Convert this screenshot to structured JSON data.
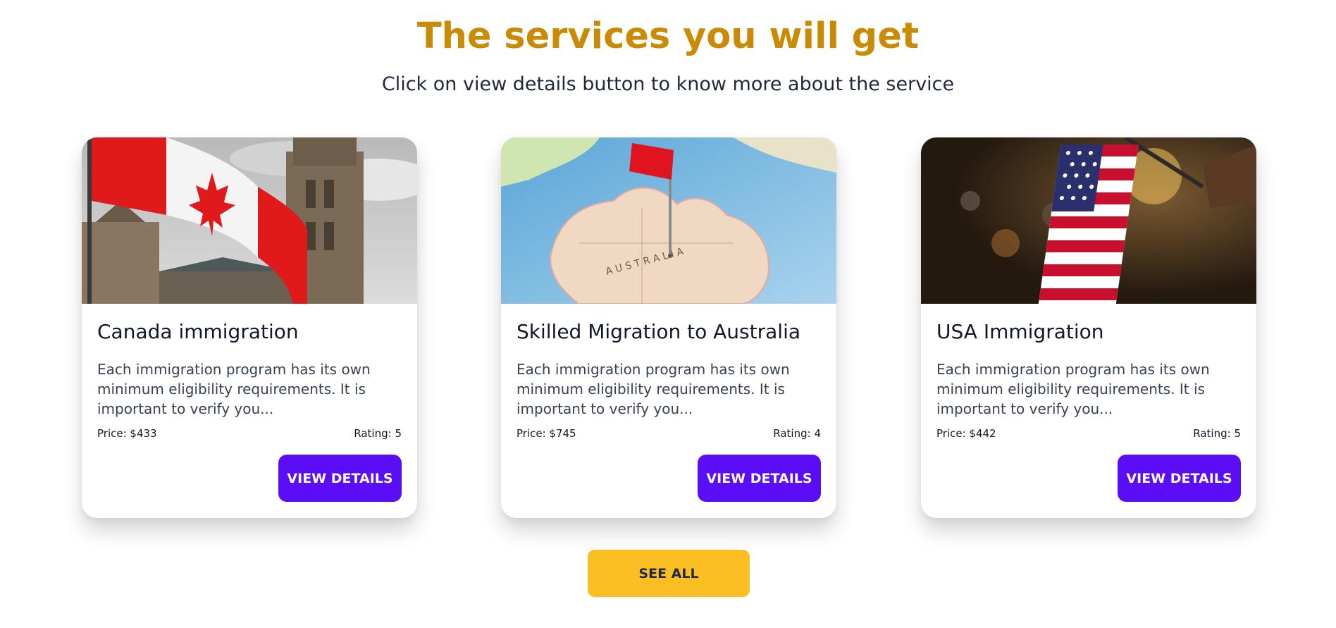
{
  "section": {
    "heading": "The services you will get",
    "subheading": "Click on view details button to know more about the service"
  },
  "colors": {
    "heading": "#ca8a04",
    "details_button": "#5b0ef5",
    "see_all_button": "#fbbf24"
  },
  "services": [
    {
      "image_icon": "canada-flag-parliament-image",
      "title": "Canada immigration",
      "description": "Each immigration program has its own minimum eligibility requirements. It is important to verify you...",
      "price": "Price: $433",
      "rating": "Rating: 5",
      "button_label": "VIEW DETAILS"
    },
    {
      "image_icon": "australia-map-pin-image",
      "title": "Skilled Migration to Australia",
      "description": "Each immigration program has its own minimum eligibility requirements. It is important to verify you...",
      "price": "Price: $745",
      "rating": "Rating: 4",
      "button_label": "VIEW DETAILS"
    },
    {
      "image_icon": "usa-flag-image",
      "title": "USA Immigration",
      "description": "Each immigration program has its own minimum eligibility requirements. It is important to verify you...",
      "price": "Price: $442",
      "rating": "Rating: 5",
      "button_label": "VIEW DETAILS"
    }
  ],
  "see_all_label": "SEE ALL"
}
